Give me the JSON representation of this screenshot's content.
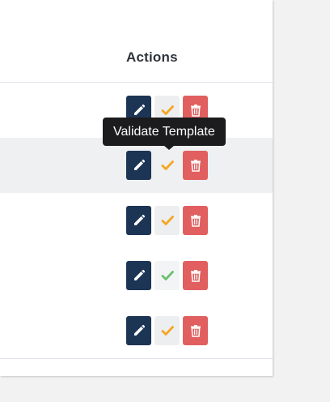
{
  "table": {
    "actions_header": "Actions",
    "rows": [
      {
        "validate_state": "pending",
        "check_color": "#f6a623"
      },
      {
        "validate_state": "pending",
        "check_color": "#f6a623"
      },
      {
        "validate_state": "pending",
        "check_color": "#f6a623"
      },
      {
        "validate_state": "validated",
        "check_color": "#6cc070"
      },
      {
        "validate_state": "pending",
        "check_color": "#f6a623"
      }
    ]
  },
  "tooltip": {
    "text": "Validate Template"
  },
  "icons": {
    "edit": "pencil-icon",
    "validate": "check-icon",
    "delete": "trash-icon"
  },
  "colors": {
    "edit_button": "#1d3554",
    "validate_button": "#eceef0",
    "delete_button": "#e15f5f",
    "pending_check": "#f6a623",
    "validated_check": "#6cc070"
  }
}
